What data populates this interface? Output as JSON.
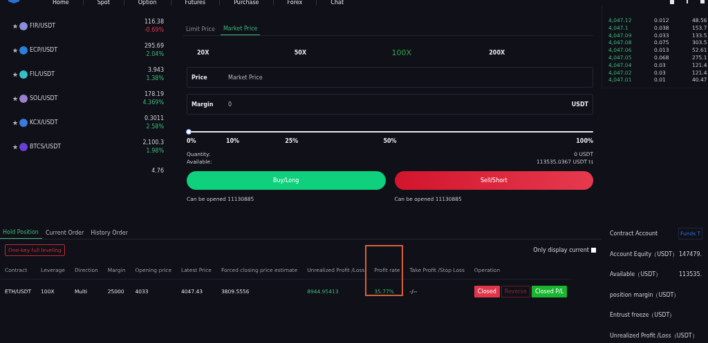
{
  "nav": {
    "items": [
      "Home",
      "Spot",
      "Option",
      "Futures",
      "Purchase",
      "Forex",
      "Chat"
    ]
  },
  "markets": [
    {
      "pair": "FIR/USDT",
      "price": "116.38",
      "change": "-0.69%",
      "falling": true,
      "color": "#8a8fd8"
    },
    {
      "pair": "ECP/USDT",
      "price": "295.69",
      "change": "2.04%",
      "falling": false,
      "color": "#2b7fe0"
    },
    {
      "pair": "FIL/USDT",
      "price": "3.943",
      "change": "1.38%",
      "falling": false,
      "color": "#36c0c8"
    },
    {
      "pair": "SOL/USDT",
      "price": "178.19",
      "change": "4.369%",
      "falling": false,
      "color": "#9a7fd0"
    },
    {
      "pair": "KCX/USDT",
      "price": "0.3011",
      "change": "2.58%",
      "falling": false,
      "color": "#3a7be0"
    },
    {
      "pair": "BTCS/USDT",
      "price": "2,100.3",
      "change": "1.98%",
      "falling": false,
      "color": "#6a3fd8"
    },
    {
      "price": "4.76"
    }
  ],
  "order_tabs": [
    {
      "label": "Limit Price",
      "selected": false
    },
    {
      "label": "Market Price",
      "selected": true
    }
  ],
  "leverage": [
    {
      "label": "20X",
      "selected": false
    },
    {
      "label": "50X",
      "selected": false
    },
    {
      "label": "100X",
      "selected": true
    },
    {
      "label": "200X",
      "selected": false
    }
  ],
  "price_field": {
    "label": "Price",
    "value": "Market Price"
  },
  "margin_field": {
    "label": "Margin",
    "value": "0",
    "unit": "USDT"
  },
  "slider": {
    "level": 0,
    "ticks": [
      "0%",
      "10%",
      "25%",
      "50%",
      "100%"
    ]
  },
  "quantity": {
    "label": "Quantity:",
    "value": "0 USDT"
  },
  "available": {
    "label": "Available:",
    "value": "113535.0367 USDT"
  },
  "buy": {
    "label": "Buy/Long",
    "note": "Can be opened 11130885"
  },
  "sell": {
    "label": "Sell/Short",
    "note": "Can be opened 11130885"
  },
  "order_book": [
    [
      "4,047.12",
      "0.012",
      "48.56"
    ],
    [
      "4,047.1",
      "0.038",
      "153.7"
    ],
    [
      "4,047.09",
      "0.033",
      "133.5"
    ],
    [
      "4,047.08",
      "0.075",
      "303.5"
    ],
    [
      "4,047.06",
      "0.013",
      "52.61"
    ],
    [
      "4,047.05",
      "0.068",
      "275.1"
    ],
    [
      "4,047.04",
      "0.03",
      "121.4"
    ],
    [
      "4,047.02",
      "0.03",
      "121.4"
    ],
    [
      "4,047.01",
      "0.01",
      "40.47"
    ]
  ],
  "position_tabs": [
    {
      "label": "Hold Position",
      "selected": true
    },
    {
      "label": "Current Order",
      "selected": false
    },
    {
      "label": "History Order",
      "selected": false
    }
  ],
  "level_all_button": "One-key full leveling",
  "only_current": {
    "label": "Only display current",
    "checked": false
  },
  "table": {
    "columns": [
      "Contract",
      "Leverage",
      "Direction",
      "Margin",
      "Opening price",
      "Latest Price",
      "Forced closing price estimate",
      "Unrealized Profit /Loss",
      "Profit rate",
      "Take Profit /Stop Loss",
      "Operation"
    ],
    "rows": [
      {
        "cells": [
          {
            "text": "ETH/USDT",
            "kind": "plain"
          },
          {
            "text": "100X",
            "kind": "plain"
          },
          {
            "text": "Multi",
            "kind": "plain"
          },
          {
            "text": "25000",
            "kind": "plain"
          },
          {
            "text": "4033",
            "kind": "plain"
          },
          {
            "text": "4047.43",
            "kind": "plain"
          },
          {
            "text": "3809.5556",
            "kind": "plain"
          },
          {
            "text": "8944.95413",
            "kind": "gain"
          },
          {
            "text": "35.77%",
            "kind": "gain"
          },
          {
            "text": "-/--",
            "kind": "plain"
          }
        ],
        "actions": [
          {
            "label": "Closed",
            "kind": "danger"
          },
          {
            "label": "Reverse",
            "kind": "outline"
          },
          {
            "label": "Closed P/L",
            "kind": "success"
          }
        ]
      }
    ]
  },
  "account": {
    "title": "Contract Account",
    "button": "Funds T",
    "rows": [
      {
        "label": "Account Equity（USDT）",
        "value": "147479."
      },
      {
        "label": "Available（USDT）",
        "value": "113535."
      },
      {
        "label": "position margin（USDT）"
      },
      {
        "label": "Entrust freeze（USDT）"
      },
      {
        "label": "Unrealized Profit /Loss（USDT）"
      }
    ]
  }
}
